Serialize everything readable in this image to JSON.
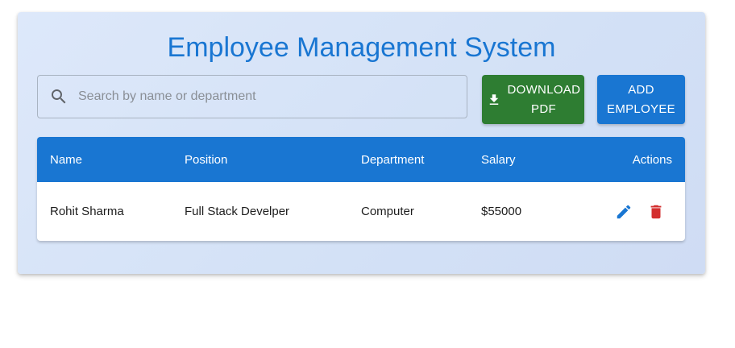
{
  "header": {
    "title": "Employee Management System"
  },
  "search": {
    "placeholder": "Search by name or department",
    "value": ""
  },
  "toolbar": {
    "download_label": "DOWNLOAD PDF",
    "add_label": "ADD EMPLOYEE"
  },
  "table": {
    "columns": [
      "Name",
      "Position",
      "Department",
      "Salary",
      "Actions"
    ],
    "rows": [
      {
        "name": "Rohit Sharma",
        "position": "Full Stack Develper",
        "department": "Computer",
        "salary": "$55000"
      }
    ]
  },
  "icons": {
    "search": "search-icon",
    "download": "download-icon",
    "edit": "edit-icon",
    "delete": "delete-icon"
  },
  "colors": {
    "primary": "#1976d2",
    "success": "#2e7d32",
    "danger": "#d32f2f"
  }
}
